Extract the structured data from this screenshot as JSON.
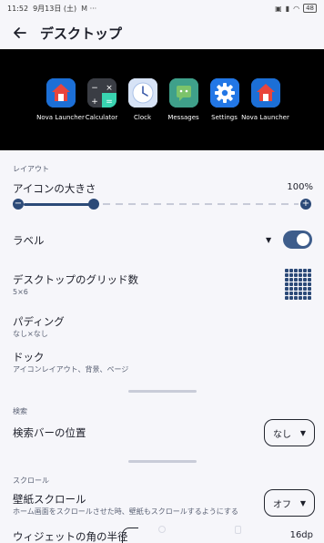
{
  "status_bar": {
    "time": "11:52",
    "date": "9月13日 (土)",
    "extras": "M ···",
    "battery": "48"
  },
  "header": {
    "title": "デスクトップ"
  },
  "preview": {
    "apps": [
      {
        "label": "Nova Launcher",
        "icon": "nova-launcher-icon"
      },
      {
        "label": "Calculator",
        "icon": "calculator-icon"
      },
      {
        "label": "Clock",
        "icon": "clock-icon"
      },
      {
        "label": "Messages",
        "icon": "messages-icon"
      },
      {
        "label": "Settings",
        "icon": "settings-gear-icon"
      },
      {
        "label": "Nova Launcher",
        "icon": "nova-launcher-icon"
      }
    ]
  },
  "layout_section": {
    "title": "レイアウト",
    "icon_size": {
      "label": "アイコンの大きさ",
      "value": "100%",
      "fraction": 0.22
    },
    "label_row": {
      "label": "ラベル",
      "enabled": true
    },
    "grid": {
      "label": "デスクトップのグリッド数",
      "value": "5×6"
    },
    "padding": {
      "label": "パディング",
      "value": "なし×なし"
    },
    "dock": {
      "label": "ドック",
      "sub": "アイコンレイアウト、背景、ページ"
    }
  },
  "search_section": {
    "title": "検索",
    "search_bar_position": {
      "label": "検索バーの位置",
      "value": "なし"
    }
  },
  "scroll_section": {
    "title": "スクロール",
    "wallpaper_scroll": {
      "label": "壁紙スクロール",
      "sub": "ホーム画面をスクロールさせた時、壁紙もスクロールするようにする",
      "value": "オフ"
    },
    "widget_radius": {
      "label": "ウィジェットの角の半径",
      "value": "16dp"
    }
  },
  "colors": {
    "accent": "#2c4a78",
    "background": "#f6f6fa"
  }
}
